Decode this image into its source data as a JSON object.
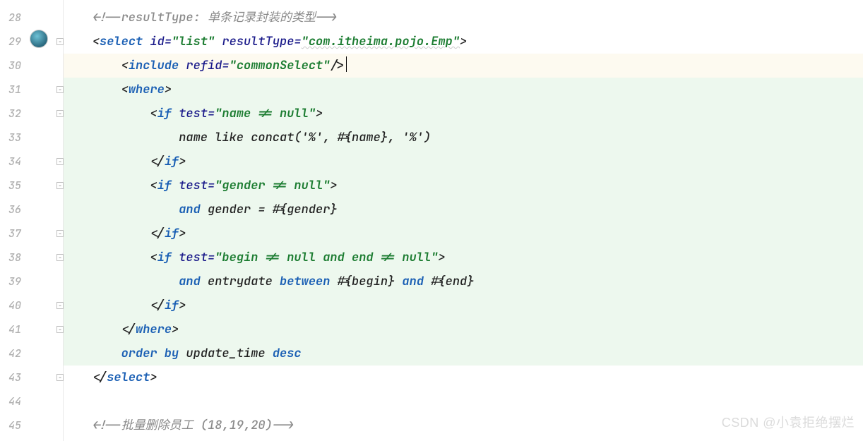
{
  "gutter": [
    "28",
    "29",
    "30",
    "31",
    "32",
    "33",
    "34",
    "35",
    "36",
    "37",
    "38",
    "39",
    "40",
    "41",
    "42",
    "43",
    "44",
    "45"
  ],
  "code": {
    "l28_comment": "<!--resultType: 单条记录封装的类型-->",
    "l29": {
      "tag_open": "<",
      "tag": "select",
      "id_attr": " id=",
      "id_val": "\"list\"",
      "rt_attr": " resultType=",
      "rt_val": "\"com.itheima.pojo.Emp\"",
      "close": ">"
    },
    "l30": {
      "tag_open": "<",
      "tag": "include",
      "refid_attr": " refid=",
      "refid_val": "\"commonSelect\"",
      "close": "/>"
    },
    "l31": {
      "tag_open": "<",
      "tag": "where",
      "close": ">"
    },
    "l32": {
      "tag_open": "<",
      "tag": "if",
      "test_attr": " test=",
      "test_val": "\"name != null\"",
      "close": ">"
    },
    "l33": "name like concat('%', #{name}, '%')",
    "l34": {
      "tag_open": "</",
      "tag": "if",
      "close": ">"
    },
    "l35": {
      "tag_open": "<",
      "tag": "if",
      "test_attr": " test=",
      "test_val": "\"gender != null\"",
      "close": ">"
    },
    "l36_pre": "and ",
    "l36_txt": "gender = #{gender}",
    "l37": {
      "tag_open": "</",
      "tag": "if",
      "close": ">"
    },
    "l38": {
      "tag_open": "<",
      "tag": "if",
      "test_attr": " test=",
      "test_val": "\"begin != null and end != null\"",
      "close": ">"
    },
    "l39_pre": "and ",
    "l39_mid": "entrydate ",
    "l39_kw": "between",
    "l39_mid2": " #{begin} ",
    "l39_kw2": "and",
    "l39_end": " #{end}",
    "l40": {
      "tag_open": "</",
      "tag": "if",
      "close": ">"
    },
    "l41": {
      "tag_open": "</",
      "tag": "where",
      "close": ">"
    },
    "l42_order": "order by",
    "l42_mid": " update_time ",
    "l42_desc": "desc",
    "l43": {
      "tag_open": "</",
      "tag": "select",
      "close": ">"
    },
    "l45_comment": "<!--批量删除员工 (18,19,20)-->"
  },
  "watermark": "CSDN @小袁拒绝摆烂"
}
